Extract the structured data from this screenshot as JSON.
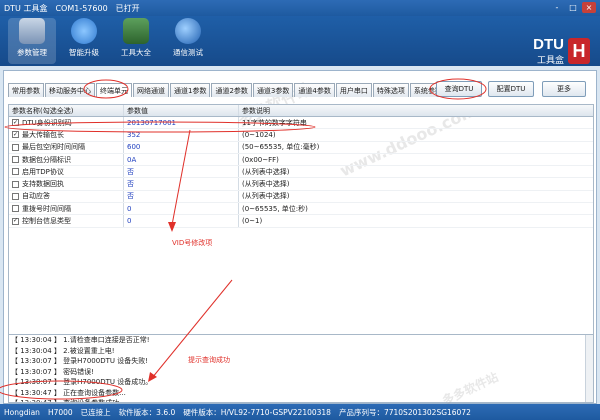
{
  "window": {
    "title": "DTU 工具盒",
    "port_status": "COM1-57600",
    "connection": "已打开",
    "controls": [
      "-",
      "□",
      "×"
    ]
  },
  "toolbar": {
    "buttons": [
      {
        "label": "参数管理",
        "icon": "database-icon",
        "color": "#8aa4c3"
      },
      {
        "label": "智能升级",
        "icon": "upgrade-arrow-icon",
        "color": "#3d8be0"
      },
      {
        "label": "工具大全",
        "icon": "toolbox-icon",
        "color": "#3b7a3b"
      },
      {
        "label": "通信测试",
        "icon": "globe-icon",
        "color": "#2a6fc7"
      }
    ],
    "brand_big": "DTU",
    "brand_small": "工具盒",
    "logo": "H"
  },
  "tabs": [
    "常用参数",
    "移动服务中心",
    "终端单元",
    "网络通道",
    "通道1参数",
    "通道2参数",
    "通道3参数",
    "通道4参数",
    "用户串口",
    "特殊选项",
    "系统参数"
  ],
  "actions": {
    "query": "查询DTU",
    "config": "配置DTU",
    "more": "更多"
  },
  "grid": {
    "headers": [
      "参数名称(勾选全选)",
      "参数值",
      "参数说明"
    ],
    "rows": [
      {
        "name": "DTU身份识别码",
        "value": "20130717001",
        "desc": "11字节的数字字符串",
        "checked": true
      },
      {
        "name": "最大传输包长",
        "value": "352",
        "desc": "(0~1024)",
        "checked": true
      },
      {
        "name": "最后包空闲时间间隔",
        "value": "600",
        "desc": "(50~65535, 单位:毫秒)",
        "checked": false
      },
      {
        "name": "数据包分隔标识",
        "value": "0A",
        "desc": "(0x00~FF)",
        "checked": false
      },
      {
        "name": "启用TDP协议",
        "value": "否",
        "desc": "(从列表中选择)",
        "checked": false
      },
      {
        "name": "支持数据回执",
        "value": "否",
        "desc": "(从列表中选择)",
        "checked": false
      },
      {
        "name": "自动应答",
        "value": "否",
        "desc": "(从列表中选择)",
        "checked": false
      },
      {
        "name": "重拨号时间间隔",
        "value": "0",
        "desc": "(0~65535, 单位:秒)",
        "checked": false
      },
      {
        "name": "控制台信息类型",
        "value": "0",
        "desc": "(0~1)",
        "checked": true
      }
    ]
  },
  "log": [
    "【 13:30:04 】 1.请检查串口连接是否正常!",
    "【 13:30:04 】 2.被设置重上电!",
    "【 13:30:07 】 登录H7000DTU 设备失败!",
    "【 13:30:07 】 密码错误!",
    "【 13:30:07 】 登录H7000DTU 设备成功。",
    "【 13:30:47 】 正在查询设备参数...",
    "【 13:30:47 】 查询设备参数成功。"
  ],
  "annotations": {
    "id_note": "VID号修改项",
    "query_note": "提示查询成功"
  },
  "watermarks": [
    "多多软件站",
    "www.ddooo.com"
  ],
  "status": {
    "company": "Hongdian",
    "model": "H7000",
    "connected": "已连接上",
    "software": "软件版本：3.6.0",
    "hardware": "硬件版本：H/VL92-7710-GSPV22100318",
    "serial": "产品序列号：7710S201302SG16072"
  },
  "colors": {
    "titlebar": "#1e5aa0",
    "accent_red": "#e0302a",
    "value_blue": "#1f3fbf"
  }
}
